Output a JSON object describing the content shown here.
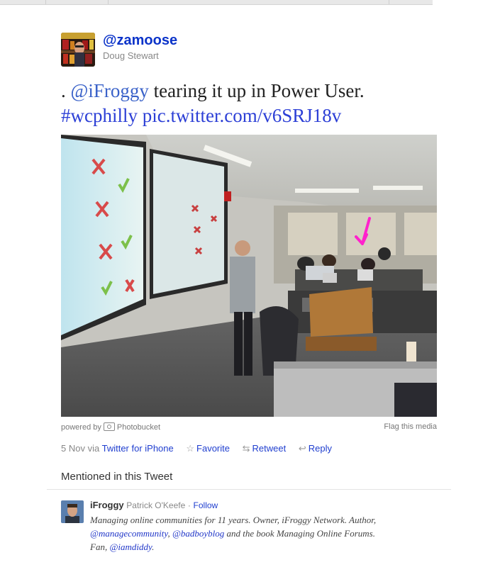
{
  "tweet": {
    "screen_name": "@zamoose",
    "full_name": "Doug Stewart",
    "text_lead": ". ",
    "mention": "@iFroggy",
    "text_mid": " tearing it up in Power User.",
    "hashtag": "#wcphilly",
    "pic_link": "pic.twitter.com/v6SRJ18v"
  },
  "media": {
    "powered_by": "powered by",
    "provider": "Photobucket",
    "flag": "Flag this media"
  },
  "meta": {
    "date": "5 Nov via",
    "source": "Twitter for iPhone",
    "favorite": "Favorite",
    "retweet": "Retweet",
    "reply": "Reply",
    "icons": [
      "star-icon",
      "retweet-icon",
      "reply-icon"
    ]
  },
  "mentioned": {
    "heading": "Mentioned in this Tweet",
    "user": {
      "name": "iFroggy",
      "real_name": "Patrick O'Keefe",
      "sep": "·",
      "follow": "Follow",
      "bio_1": "Managing online communities for 11 years. Owner, iFroggy Network. Author, ",
      "bio_link1": "@managecommunity",
      "bio_2": ", ",
      "bio_link2": "@badboyblog",
      "bio_3": " and the book Managing Online Forums. Fan, ",
      "bio_link3": "@iamdiddy",
      "bio_4": "."
    }
  },
  "colors": {
    "link": "#1f3ecf",
    "screen_name": "#0b33c9",
    "arrow": "#ff22cc"
  }
}
